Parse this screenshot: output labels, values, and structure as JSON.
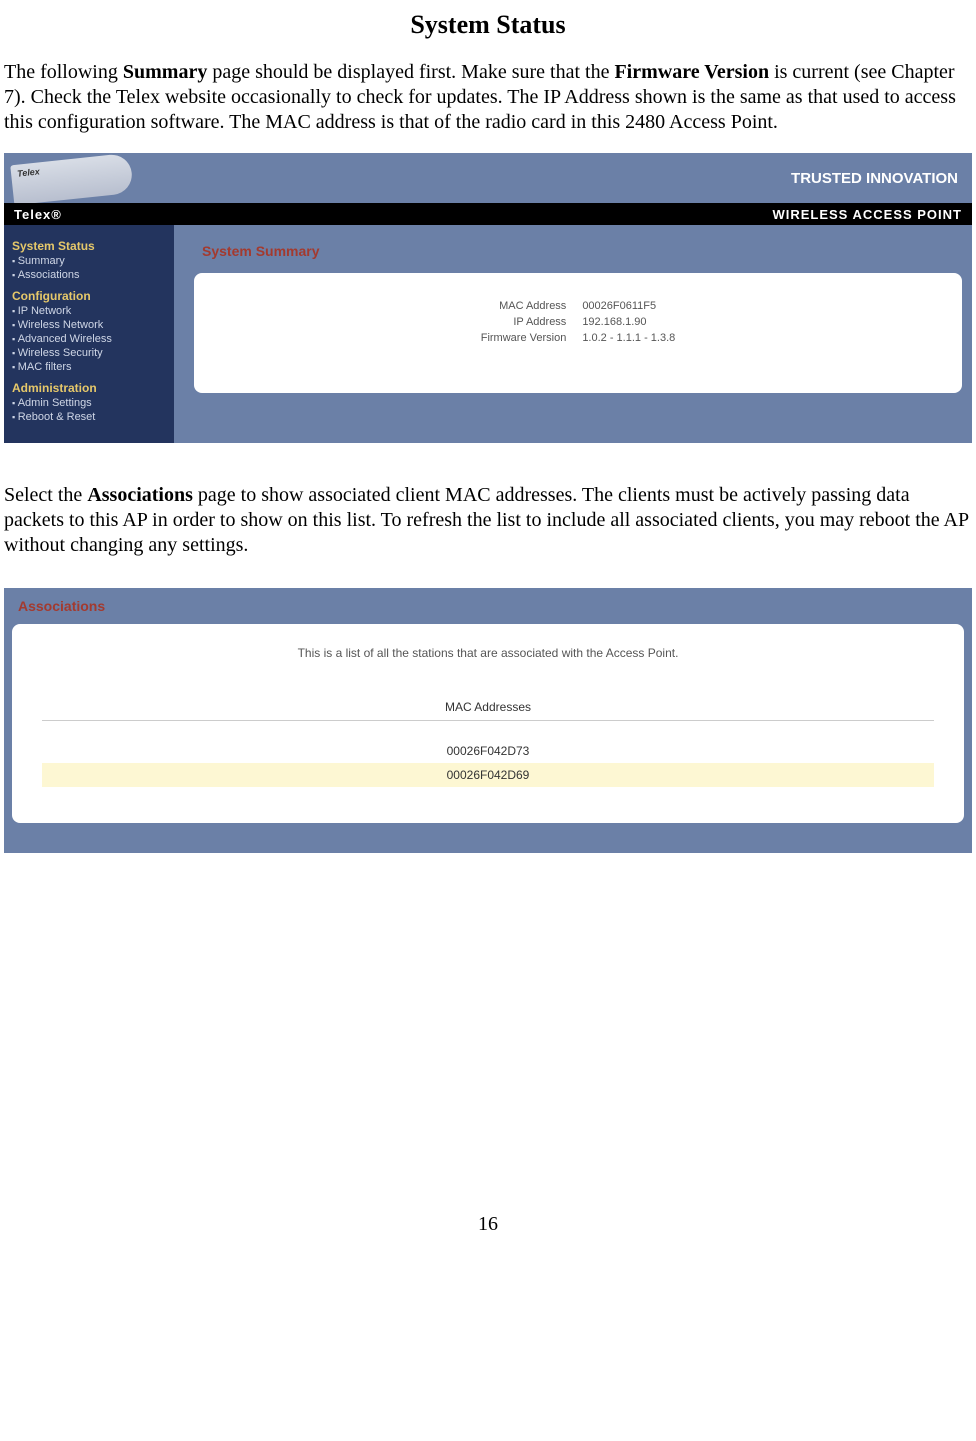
{
  "doc": {
    "title": "System Status",
    "para1_pre": "The following ",
    "para1_b1": "Summary",
    "para1_mid1": " page should be displayed first. Make sure that the ",
    "para1_b2": "Firmware Version",
    "para1_post": " is current (see Chapter 7).  Check the Telex website occasionally to check for updates.  The IP Address shown is the same as that used to access this configuration software.  The MAC address is that of the radio card in this 2480 Access Point.",
    "para2_pre": "Select the ",
    "para2_b1": "Associations",
    "para2_post": " page to show associated client MAC addresses.  The clients must be actively passing data packets to this AP in order to show on this list. To refresh the list to include all associated clients, you may reboot the AP without changing any settings.",
    "page_number": "16"
  },
  "scr1": {
    "banner_right": "TRUSTED INNOVATION",
    "antenna_label": "Telex",
    "brand_left": "Telex®",
    "brand_right": "WIRELESS ACCESS POINT",
    "nav": {
      "sec1_title": "System Status",
      "sec1_items": [
        "Summary",
        "Associations"
      ],
      "sec2_title": "Configuration",
      "sec2_items": [
        "IP Network",
        "Wireless Network",
        "Advanced Wireless",
        "Wireless Security",
        "MAC filters"
      ],
      "sec3_title": "Administration",
      "sec3_items": [
        "Admin Settings",
        "Reboot & Reset"
      ]
    },
    "panel_title": "System Summary",
    "fields": {
      "mac_label": "MAC Address",
      "mac_value": "00026F0611F5",
      "ip_label": "IP Address",
      "ip_value": "192.168.1.90",
      "fw_label": "Firmware Version",
      "fw_value": "1.0.2 - 1.1.1 - 1.3.8"
    }
  },
  "scr2": {
    "panel_title": "Associations",
    "description": "This is a list of all the stations that are associated with the Access Point.",
    "col_header": "MAC Addresses",
    "rows": [
      "00026F042D73",
      "00026F042D69"
    ]
  }
}
